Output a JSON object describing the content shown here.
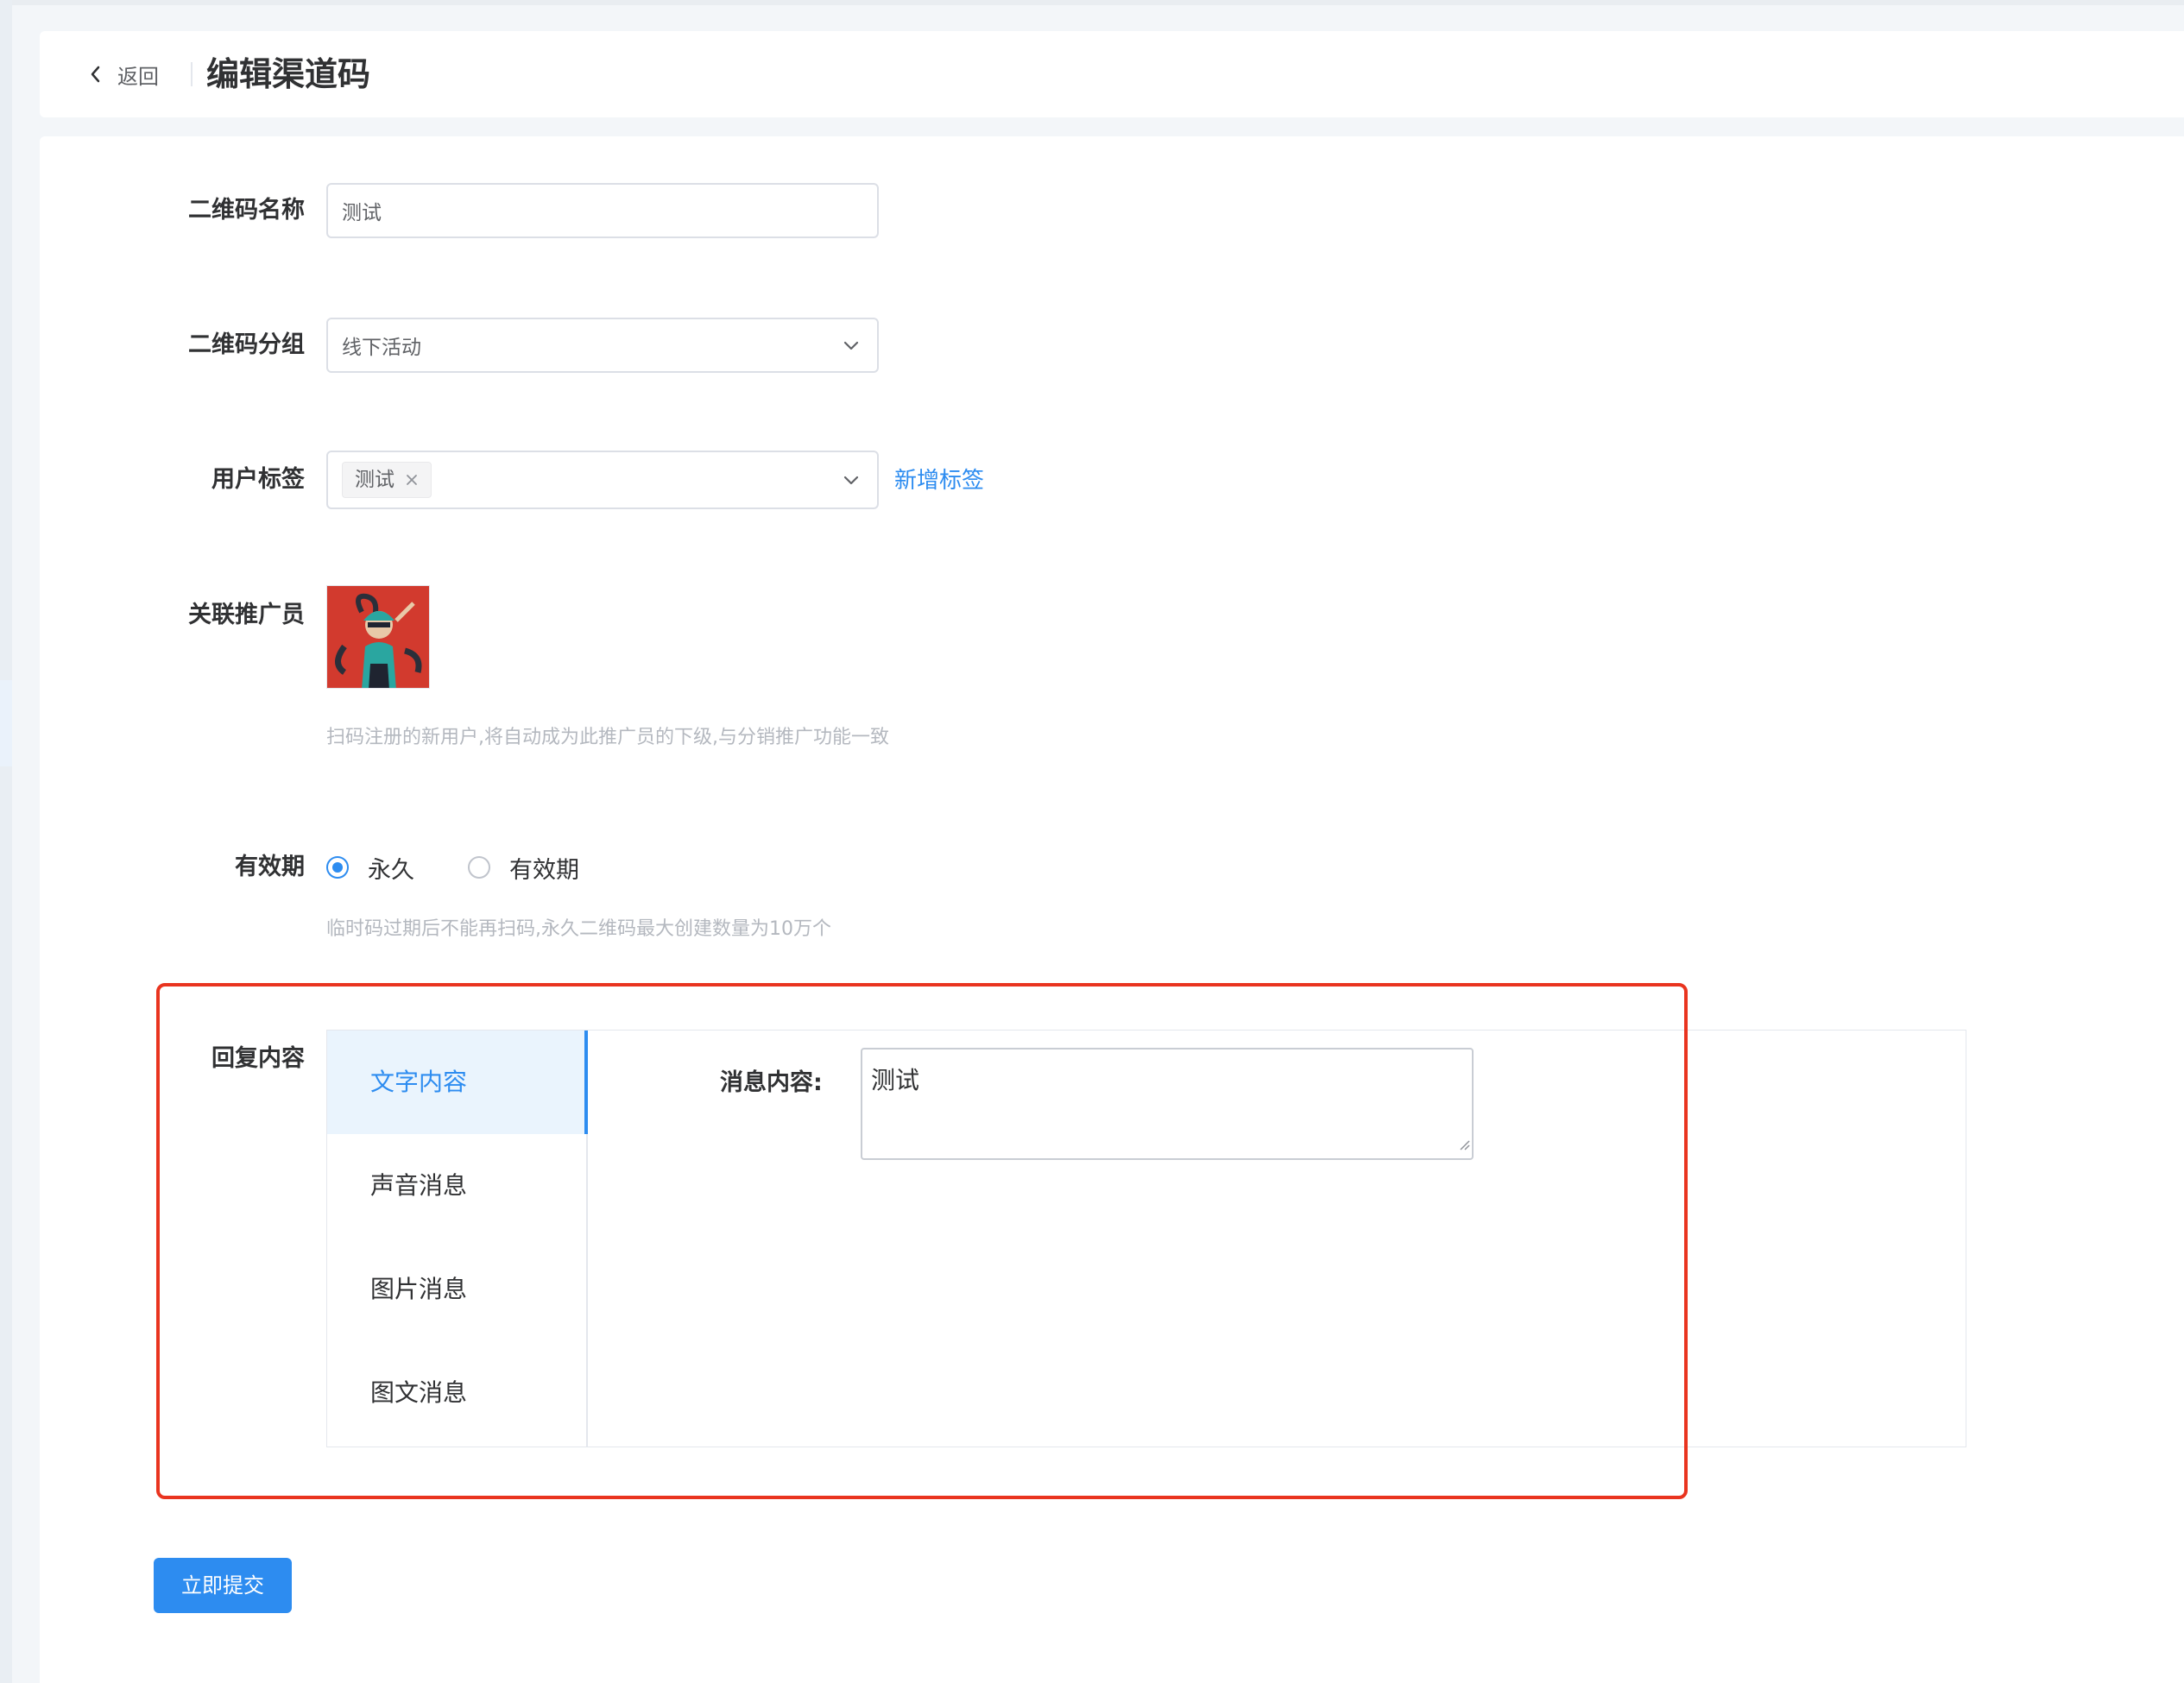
{
  "header": {
    "back_label": "返回",
    "title": "编辑渠道码"
  },
  "form": {
    "qr_name": {
      "label": "二维码名称",
      "value": "测试"
    },
    "qr_group": {
      "label": "二维码分组",
      "selected": "线下活动"
    },
    "user_tag": {
      "label": "用户标签",
      "tags": [
        "测试"
      ],
      "add_link": "新增标签"
    },
    "promoter": {
      "label": "关联推广员",
      "hint": "扫码注册的新用户,将自动成为此推广员的下级,与分销推广功能一致"
    },
    "validity": {
      "label": "有效期",
      "options": [
        {
          "label": "永久",
          "checked": true
        },
        {
          "label": "有效期",
          "checked": false
        }
      ],
      "hint": "临时码过期后不能再扫码,永久二维码最大创建数量为10万个"
    },
    "reply": {
      "label": "回复内容",
      "tabs": [
        {
          "label": "文字内容",
          "active": true
        },
        {
          "label": "声音消息",
          "active": false
        },
        {
          "label": "图片消息",
          "active": false
        },
        {
          "label": "图文消息",
          "active": false
        }
      ],
      "message_label": "消息内容:",
      "message_value": "测试"
    },
    "submit_label": "立即提交"
  },
  "colors": {
    "accent": "#2d8cf0",
    "highlight_border": "#e9341f",
    "avatar_bg": "#d23a2e"
  },
  "icons": {
    "back": "chevron-left-icon",
    "select": "chevron-down-icon",
    "tag_close": "close-icon",
    "textarea_resize": "resize-handle-icon"
  }
}
